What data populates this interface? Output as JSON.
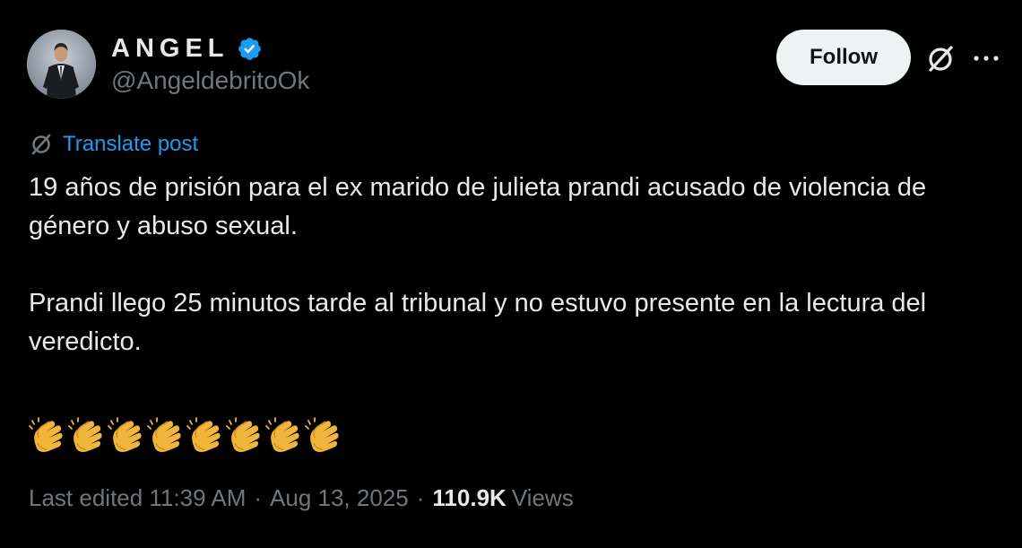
{
  "author": {
    "display_name": "ANGEL",
    "handle": "@AngeldebritoOk",
    "verified": true,
    "verified_color": "#1d9bf0"
  },
  "actions": {
    "follow_label": "Follow",
    "grok_icon": "grok-slash-icon",
    "more_icon": "more-horizontal-icon"
  },
  "translate": {
    "label": "Translate post",
    "icon": "grok-translate-icon",
    "color": "#1d9bf0"
  },
  "post": {
    "paragraph_1": "19 años de prisión para el ex marido de julieta prandi acusado de violencia de género y abuso sexual.",
    "paragraph_2": "Prandi llego 25 minutos tarde al tribunal y no estuvo presente en la lectura del veredicto.",
    "emoji": "👏👏👏👏👏👏👏👏",
    "emoji_icon": "clapping-hands-icon",
    "emoji_count": 8
  },
  "meta": {
    "edited_label": "Last edited 11:39 AM",
    "separator": "·",
    "date": "Aug 13, 2025",
    "views_count": "110.9K",
    "views_label": "Views"
  },
  "colors": {
    "background": "#000000",
    "text_primary": "#e7e9ea",
    "text_secondary": "#71767b",
    "accent": "#1d9bf0",
    "follow_bg": "#eff3f4"
  }
}
